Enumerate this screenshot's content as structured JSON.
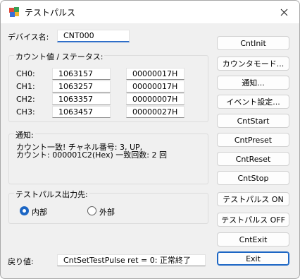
{
  "window": {
    "title": "テストパルス"
  },
  "device": {
    "label": "デバイス名:",
    "value": "CNT000"
  },
  "counts": {
    "group_title": "カウント値 / ステータス:",
    "rows": [
      {
        "label": "CH0:",
        "value": "1063157",
        "status": "00000017H"
      },
      {
        "label": "CH1:",
        "value": "1063257",
        "status": "00000017H"
      },
      {
        "label": "CH2:",
        "value": "1063357",
        "status": "00000007H"
      },
      {
        "label": "CH3:",
        "value": "1063457",
        "status": "00000027H"
      }
    ]
  },
  "notice": {
    "group_title": "通知:",
    "line1": "カウント一致! チャネル番号: 3, UP,",
    "line2": "カウント: 000001C2(Hex) 一致回数: 2 回"
  },
  "pulse": {
    "group_title": "テストパルス出力先:",
    "options": [
      {
        "label": "内部",
        "selected": true
      },
      {
        "label": "外部",
        "selected": false
      }
    ]
  },
  "result": {
    "label": "戻り値:",
    "value": "CntSetTestPulse ret = 0: 正常終了"
  },
  "buttons": {
    "init": "CntInit",
    "counter_mode": "カウンタモード...",
    "notify": "通知...",
    "event_settings": "イベント設定...",
    "start": "CntStart",
    "preset": "CntPreset",
    "reset": "CntReset",
    "stop": "CntStop",
    "pulse_on": "テストパルス ON",
    "pulse_off": "テストパルス OFF",
    "exit_cnt": "CntExit",
    "exit": "Exit"
  },
  "colors": {
    "accent": "#1c66c4",
    "window_bg": "#f0f0f0",
    "titlebar_bg": "#ffffff"
  }
}
